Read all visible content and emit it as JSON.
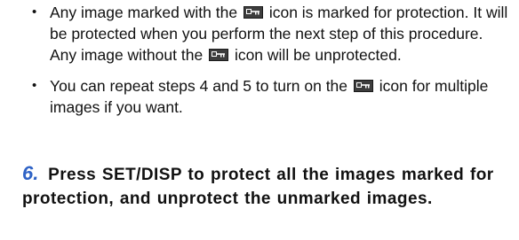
{
  "bullets": [
    {
      "before_icon": "Any image marked with the",
      "after_icon": "icon is marked for protection. It will be protected when you perform the next step of this procedure. Any image without the",
      "after_icon2": "icon will be unprotected."
    },
    {
      "before_icon": "You can repeat steps 4 and 5 to turn on the",
      "after_icon": "icon for multiple images if you want."
    }
  ],
  "step": {
    "number": "6.",
    "text": "Press SET/DISP to protect all the images marked for protection, and unprotect the unmarked images."
  },
  "icons": {
    "protect": "key-protect-icon",
    "bullet": "bullet-dot"
  },
  "colors": {
    "step_number": "#2f63c6",
    "icon_background": "#3d3d3d"
  }
}
